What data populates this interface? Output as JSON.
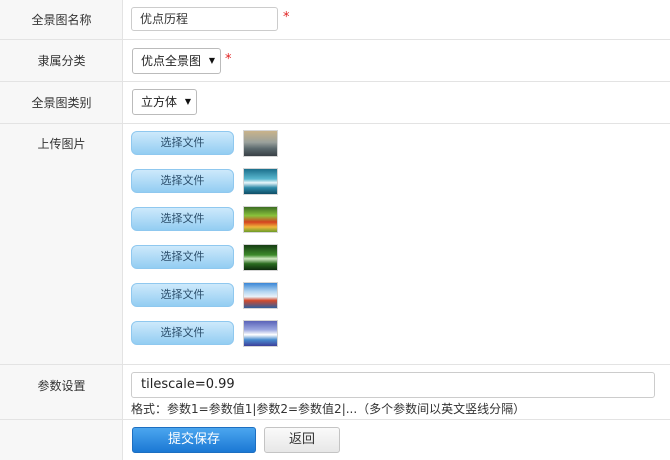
{
  "form": {
    "panorama_name": {
      "label": "全景图名称",
      "value": "优点历程",
      "required_mark": "*"
    },
    "category": {
      "label": "隶属分类",
      "selected": "优点全景图",
      "required_mark": "*"
    },
    "panorama_type": {
      "label": "全景图类别",
      "selected": "立方体"
    },
    "upload": {
      "label": "上传图片",
      "files": [
        {
          "button_label": "选择文件",
          "thumbnail": "image-thumbnail"
        },
        {
          "button_label": "选择文件",
          "thumbnail": "image-thumbnail"
        },
        {
          "button_label": "选择文件",
          "thumbnail": "image-thumbnail"
        },
        {
          "button_label": "选择文件",
          "thumbnail": "image-thumbnail"
        },
        {
          "button_label": "选择文件",
          "thumbnail": "image-thumbnail"
        },
        {
          "button_label": "选择文件",
          "thumbnail": "image-thumbnail"
        }
      ]
    },
    "params": {
      "label": "参数设置",
      "value": "tilescale=0.99",
      "hint": "格式：参数1=参数值1|参数2=参数值2|...（多个参数间以英文竖线分隔）"
    },
    "actions": {
      "submit_label": "提交保存",
      "back_label": "返回"
    }
  },
  "colors": {
    "required": "#e02020",
    "primary_button": "#1b78d4",
    "file_button": "#93cdf2",
    "label_background": "#f7f7f7"
  },
  "icons": {
    "select_arrow": "triangle-down-icon"
  }
}
